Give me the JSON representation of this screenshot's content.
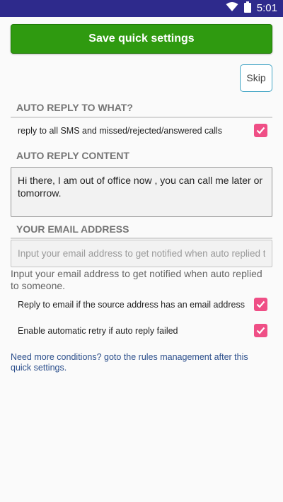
{
  "status_bar": {
    "time": "5:01",
    "icons": [
      "wifi-icon",
      "battery-icon"
    ],
    "background_color": "#2e2a8c"
  },
  "actions": {
    "save_label": "Save quick settings",
    "save_color": "#2f9a10",
    "skip_label": "Skip"
  },
  "sections": {
    "reply_target": {
      "header": "AUTO REPLY TO WHAT?",
      "option_label": "reply to all SMS and missed/rejected/answered calls",
      "option_checked": true
    },
    "reply_content": {
      "header": "AUTO REPLY CONTENT",
      "message": "Hi there, I am out of office now , you can call me later or tomorrow."
    },
    "email": {
      "header": "YOUR EMAIL ADDRESS",
      "value": "",
      "placeholder": "Input your email address to get notified when auto replied to someone.",
      "helper": "Input your email address to get notified when auto replied to someone."
    }
  },
  "options": [
    {
      "label": "Reply to email if the source address has an email address",
      "checked": true
    },
    {
      "label": "Enable automatic retry if auto reply failed",
      "checked": true
    }
  ],
  "footer": {
    "link_text": "Need more conditions? goto the rules management after this quick settings."
  },
  "colors": {
    "checkbox_accent": "#ef4f86",
    "link": "#2c4f8c",
    "skip_border": "#42a5c5"
  }
}
